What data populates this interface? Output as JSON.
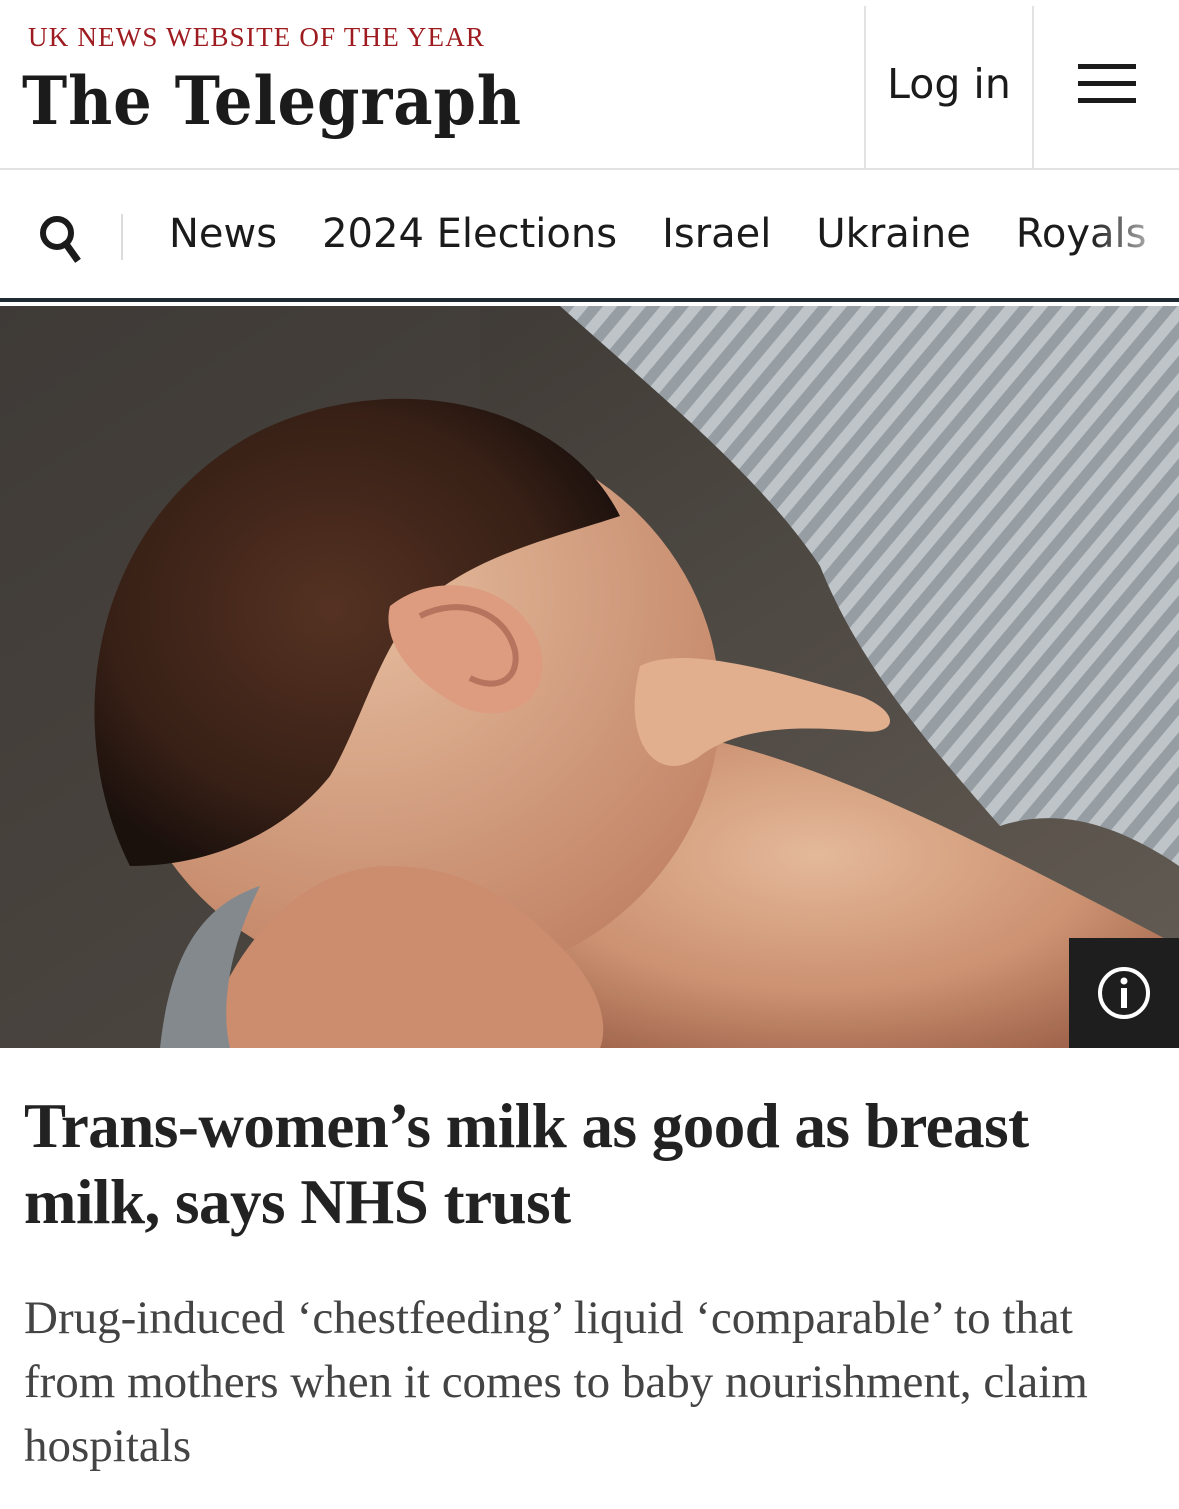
{
  "header": {
    "tagline": "UK NEWS WEBSITE OF THE YEAR",
    "logo": "The Telegraph",
    "login_label": "Log in"
  },
  "nav": {
    "items": [
      "News",
      "2024 Elections",
      "Israel",
      "Ukraine",
      "Royals"
    ]
  },
  "hero": {
    "description_icon": "info-icon"
  },
  "article": {
    "headline": "Trans-women’s milk as good as breast milk, says NHS trust",
    "standfirst": "Drug-induced ‘chestfeeding’ liquid ‘comparable’ to that from mothers when it comes to baby nourishment, claim hospitals"
  },
  "colors": {
    "tagline": "#9e1b20",
    "nav_border": "#1f2a33",
    "text": "#222222"
  }
}
